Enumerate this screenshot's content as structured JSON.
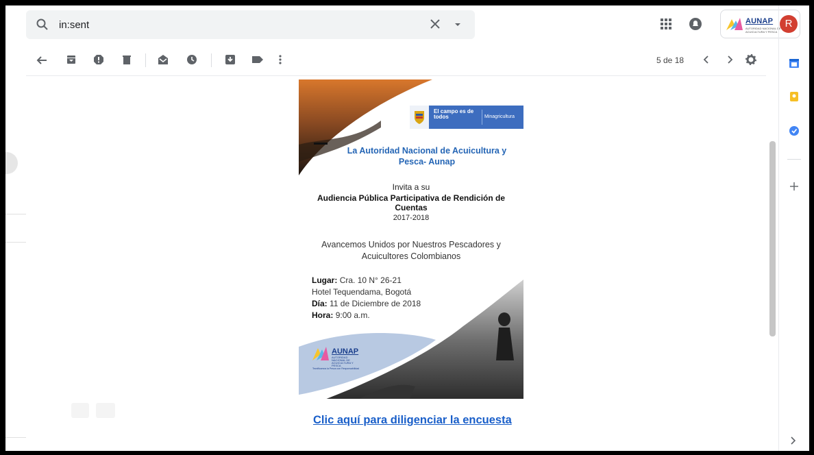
{
  "search": {
    "value": "in:sent"
  },
  "account": {
    "brand": "AUNAP",
    "brand_sub": "AUTORIDAD NACIONAL DE ACUICULTURA Y PESCA",
    "avatar_letter": "R",
    "avatar_color": "#d23f31"
  },
  "toolbar": {
    "pager": "5 de 18"
  },
  "flyer": {
    "gov_brand": "El campo es de todos",
    "gov_ministry": "Minagricultura",
    "title": "La Autoridad Nacional de Acuicultura y Pesca- Aunap",
    "invite": "Invita a su",
    "event": "Audiencia Pública Participativa de Rendición de Cuentas",
    "years": "2017-2018",
    "slogan": "Avancemos Unidos por Nuestros Pescadores y Acuicultores Colombianos",
    "lugar_label": "Lugar:",
    "lugar_value": "Cra. 10 N° 26-21",
    "hotel": "Hotel Tequendama, Bogotá",
    "dia_label": "Día:",
    "dia_value": "11 de Diciembre de 2018",
    "hora_label": "Hora:",
    "hora_value": "9:00 a.m.",
    "logo_name": "AUNAP",
    "logo_sub": "AUTORIDAD NACIONAL DE ACUICULTURA Y PESCA",
    "logo_tagline": "Tecnificamos la Pesca con Responsabilidad",
    "accent_color": "#2465b5"
  },
  "survey_link": "Clic aquí para diligenciar la encuesta"
}
